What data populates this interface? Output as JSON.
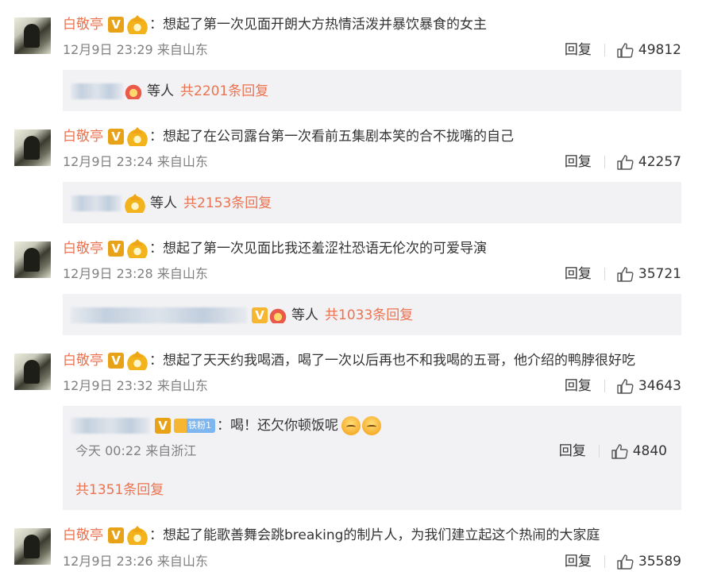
{
  "comments": [
    {
      "author": "白敬亭",
      "vip_badge": "V",
      "text": "想起了第一次见面开朗大方热情活泼并暴饮暴食的女主",
      "time": "12月9日 23:29 来自山东",
      "reply_label": "回复",
      "likes": "49812",
      "thread_etc": "等人",
      "thread_total": "共2201条回复"
    },
    {
      "author": "白敬亭",
      "vip_badge": "V",
      "text": "想起了在公司露台第一次看前五集剧本笑的合不拢嘴的自己",
      "time": "12月9日 23:24 来自山东",
      "reply_label": "回复",
      "likes": "42257",
      "thread_etc": "等人",
      "thread_total": "共2153条回复"
    },
    {
      "author": "白敬亭",
      "vip_badge": "V",
      "text": "想起了第一次见面比我还羞涩社恐语无伦次的可爱导演",
      "time": "12月9日 23:28 来自山东",
      "reply_label": "回复",
      "likes": "35721",
      "thread_etc": "等人",
      "thread_total": "共1033条回复"
    },
    {
      "author": "白敬亭",
      "vip_badge": "V",
      "text": "想起了天天约我喝酒，喝了一次以后再也不和我喝的五哥，他介绍的鸭脖很好吃",
      "time": "12月9日 23:32 来自山东",
      "reply_label": "回复",
      "likes": "34643",
      "sub_reply": {
        "vip_badge": "V",
        "fan_badge": "铁粉1",
        "text": "喝！还欠你顿饭呢",
        "time": "今天 00:22 来自浙江",
        "reply_label": "回复",
        "likes": "4840"
      },
      "thread_total": "共1351条回复"
    },
    {
      "author": "白敬亭",
      "vip_badge": "V",
      "text": "想起了能歌善舞会跳breaking的制片人，为我们建立起这个热闹的大家庭",
      "time": "12月9日 23:26 来自山东",
      "reply_label": "回复",
      "likes": "35589"
    }
  ],
  "colors": {
    "accent": "#eb7350",
    "meta": "#808080",
    "reply_box_bg": "#f2f2f5"
  }
}
